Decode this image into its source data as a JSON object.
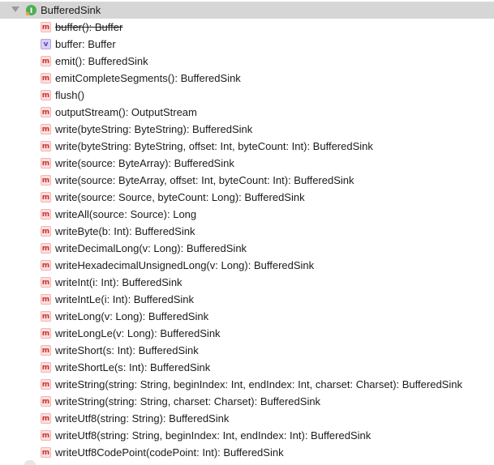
{
  "tree": {
    "class": {
      "name": "BufferedSink",
      "icon": "interface-icon"
    },
    "members": [
      {
        "kind": "m",
        "label": "buffer(): Buffer",
        "deprecated": true
      },
      {
        "kind": "v",
        "label": "buffer: Buffer",
        "deprecated": false
      },
      {
        "kind": "m",
        "label": "emit(): BufferedSink",
        "deprecated": false
      },
      {
        "kind": "m",
        "label": "emitCompleteSegments(): BufferedSink",
        "deprecated": false
      },
      {
        "kind": "m",
        "label": "flush()",
        "deprecated": false
      },
      {
        "kind": "m",
        "label": "outputStream(): OutputStream",
        "deprecated": false
      },
      {
        "kind": "m",
        "label": "write(byteString: ByteString): BufferedSink",
        "deprecated": false
      },
      {
        "kind": "m",
        "label": "write(byteString: ByteString, offset: Int, byteCount: Int): BufferedSink",
        "deprecated": false
      },
      {
        "kind": "m",
        "label": "write(source: ByteArray): BufferedSink",
        "deprecated": false
      },
      {
        "kind": "m",
        "label": "write(source: ByteArray, offset: Int, byteCount: Int): BufferedSink",
        "deprecated": false
      },
      {
        "kind": "m",
        "label": "write(source: Source, byteCount: Long): BufferedSink",
        "deprecated": false
      },
      {
        "kind": "m",
        "label": "writeAll(source: Source): Long",
        "deprecated": false
      },
      {
        "kind": "m",
        "label": "writeByte(b: Int): BufferedSink",
        "deprecated": false
      },
      {
        "kind": "m",
        "label": "writeDecimalLong(v: Long): BufferedSink",
        "deprecated": false
      },
      {
        "kind": "m",
        "label": "writeHexadecimalUnsignedLong(v: Long): BufferedSink",
        "deprecated": false
      },
      {
        "kind": "m",
        "label": "writeInt(i: Int): BufferedSink",
        "deprecated": false
      },
      {
        "kind": "m",
        "label": "writeIntLe(i: Int): BufferedSink",
        "deprecated": false
      },
      {
        "kind": "m",
        "label": "writeLong(v: Long): BufferedSink",
        "deprecated": false
      },
      {
        "kind": "m",
        "label": "writeLongLe(v: Long): BufferedSink",
        "deprecated": false
      },
      {
        "kind": "m",
        "label": "writeShort(s: Int): BufferedSink",
        "deprecated": false
      },
      {
        "kind": "m",
        "label": "writeShortLe(s: Int): BufferedSink",
        "deprecated": false
      },
      {
        "kind": "m",
        "label": "writeString(string: String, beginIndex: Int, endIndex: Int, charset: Charset): BufferedSink",
        "deprecated": false
      },
      {
        "kind": "m",
        "label": "writeString(string: String, charset: Charset): BufferedSink",
        "deprecated": false
      },
      {
        "kind": "m",
        "label": "writeUtf8(string: String): BufferedSink",
        "deprecated": false
      },
      {
        "kind": "m",
        "label": "writeUtf8(string: String, beginIndex: Int, endIndex: Int): BufferedSink",
        "deprecated": false
      },
      {
        "kind": "m",
        "label": "writeUtf8CodePoint(codePoint: Int): BufferedSink",
        "deprecated": false
      }
    ]
  },
  "colors": {
    "selection_bg": "#d6d6d6",
    "method_icon_text": "#c8342d",
    "variable_icon_text": "#5a3fc0",
    "interface_icon_green": "#4fae54"
  }
}
